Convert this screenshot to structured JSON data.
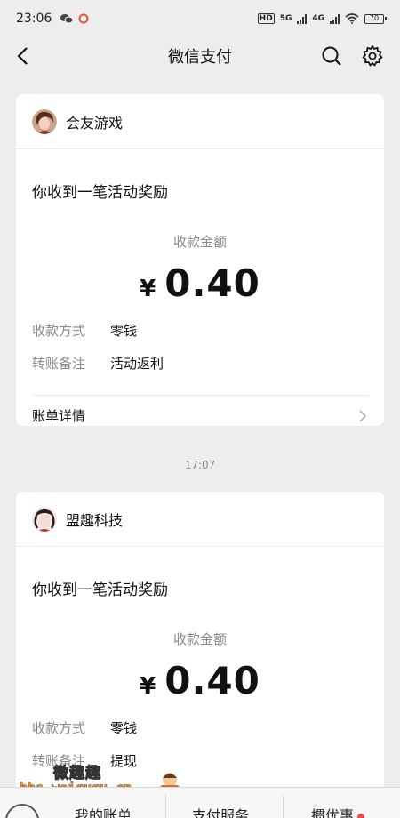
{
  "status_bar": {
    "time": "23:06",
    "network1": "HD",
    "network2": "5G",
    "network3": "4G",
    "battery": "70"
  },
  "nav": {
    "title": "微信支付"
  },
  "cards": [
    {
      "merchant": "会友游戏",
      "message": "你收到一笔活动奖励",
      "amount_label": "收款金额",
      "currency": "¥",
      "amount": "0.40",
      "rows": [
        {
          "label": "收款方式",
          "value": "零钱"
        },
        {
          "label": "转账备注",
          "value": "活动返利"
        }
      ],
      "bill_label": "账单详情"
    },
    {
      "merchant": "盟趣科技",
      "message": "你收到一笔活动奖励",
      "amount_label": "收款金额",
      "currency": "¥",
      "amount": "0.40",
      "rows": [
        {
          "label": "收款方式",
          "value": "零钱"
        },
        {
          "label": "转账备注",
          "value": "提现"
        }
      ]
    }
  ],
  "timestamp": "17:07",
  "watermark": {
    "title": "微趣趣",
    "url": "bbs.weiququ.cn"
  },
  "tabs": {
    "my_bill": "我的账单",
    "pay_service": "支付服务",
    "deals": "掼优惠"
  },
  "colors": {
    "background": "#ededed",
    "card": "#ffffff",
    "muted_text": "#8a8a8a",
    "badge": "#f04848"
  }
}
